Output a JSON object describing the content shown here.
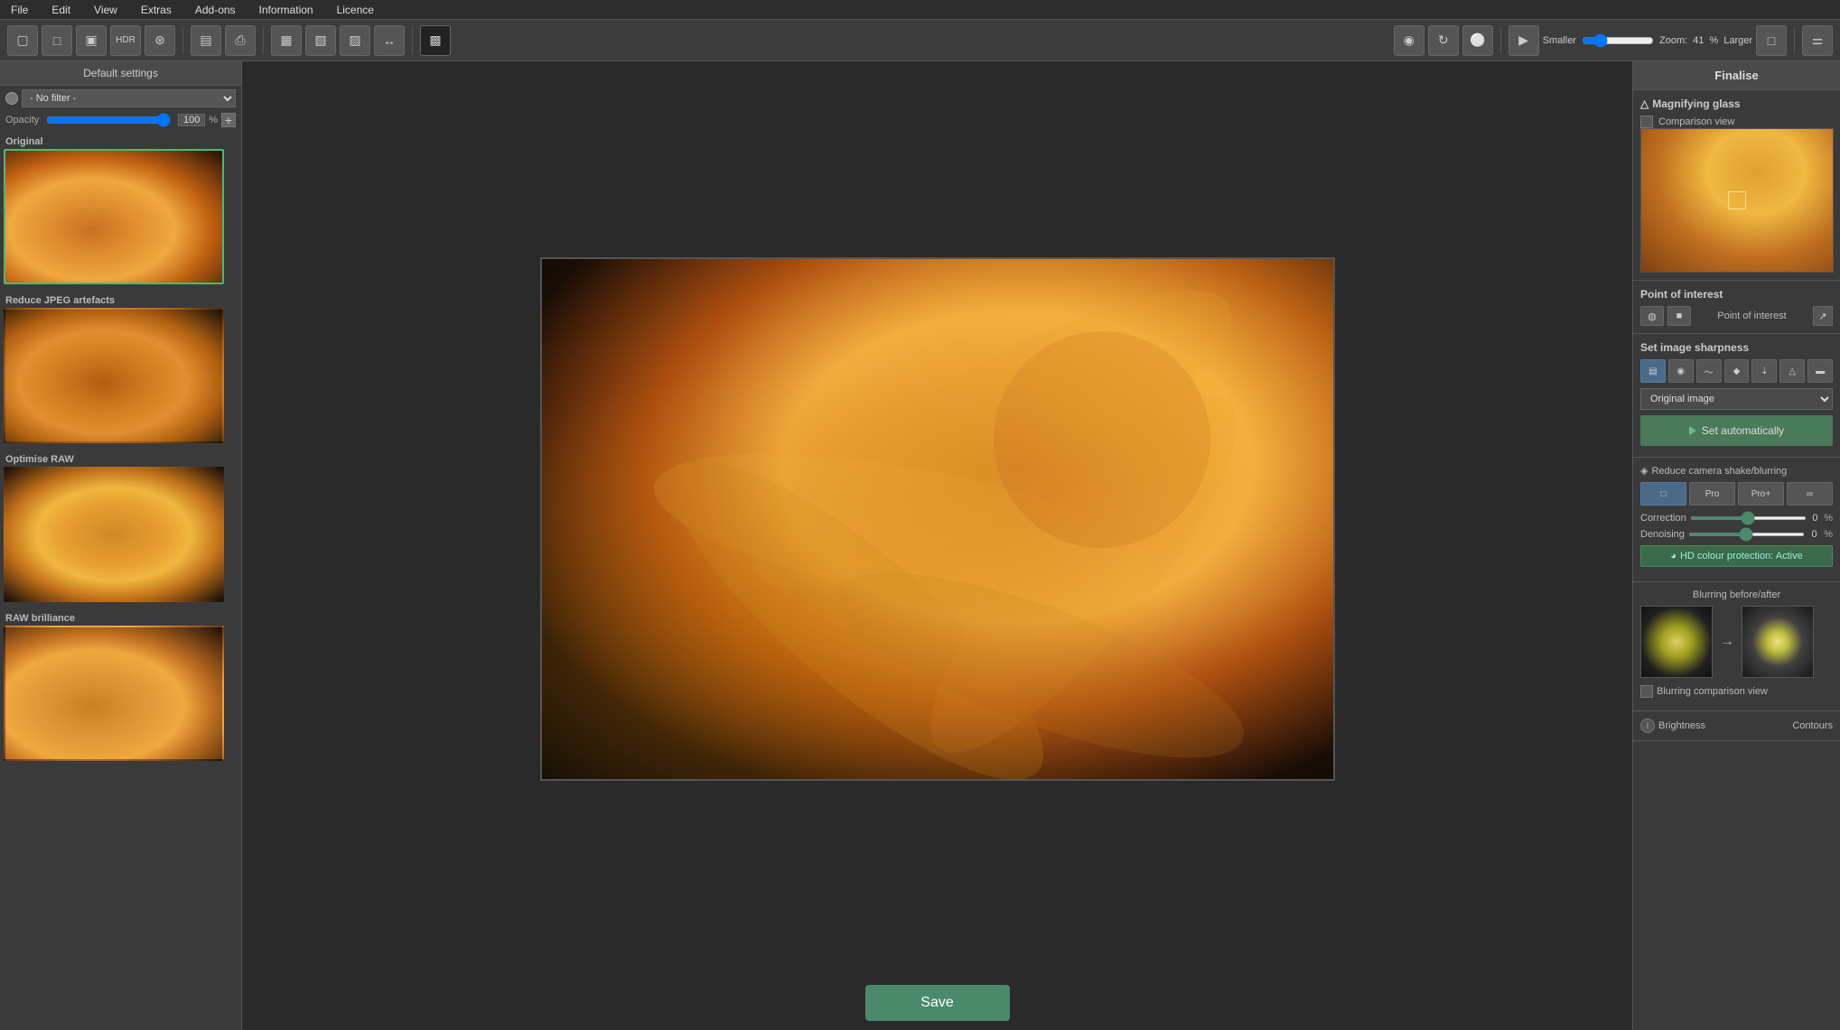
{
  "menubar": {
    "items": [
      "File",
      "Edit",
      "View",
      "Extras",
      "Add-ons",
      "Information",
      "Licence"
    ]
  },
  "toolbar": {
    "zoom": {
      "label": "Zoom:",
      "value": "41",
      "unit": "%",
      "smaller": "Smaller",
      "larger": "Larger"
    }
  },
  "sidebar": {
    "header": "Default settings",
    "filter": "- No filter -",
    "opacity_label": "Opacity",
    "opacity_value": "100",
    "opacity_unit": "%",
    "presets": [
      {
        "label": "Original"
      },
      {
        "label": "Reduce JPEG artefacts"
      },
      {
        "label": "Optimise RAW"
      },
      {
        "label": "RAW brilliance"
      }
    ]
  },
  "right_panel": {
    "title": "Finalise",
    "magnifying_glass": {
      "title": "Magnifying glass",
      "comparison_view": "Comparison view"
    },
    "point_of_interest": {
      "title": "Point of interest",
      "label": "Point of interest"
    },
    "sharpness": {
      "title": "Set image sharpness",
      "dropdown": "Original image",
      "set_auto_label": "Set automatically",
      "icons": [
        "▦",
        "◉",
        "〜",
        "◆",
        "↓",
        "▲",
        "▬"
      ]
    },
    "camera_shake": {
      "title": "Reduce camera shake/blurring",
      "buttons": [
        "⬜",
        "Pro",
        "Pro+",
        "∞"
      ],
      "correction_label": "Correction",
      "correction_value": "0",
      "correction_unit": "%",
      "denoising_label": "Denoising",
      "denoising_value": "0",
      "denoising_unit": "%",
      "hd_protection": "HD colour protection: Active"
    },
    "blurring": {
      "title": "Blurring before/after",
      "comparison_label": "Blurring comparison view"
    },
    "bottom": {
      "brightness_label": "Brightness",
      "contours_label": "Contours"
    }
  },
  "save_button": "Save"
}
